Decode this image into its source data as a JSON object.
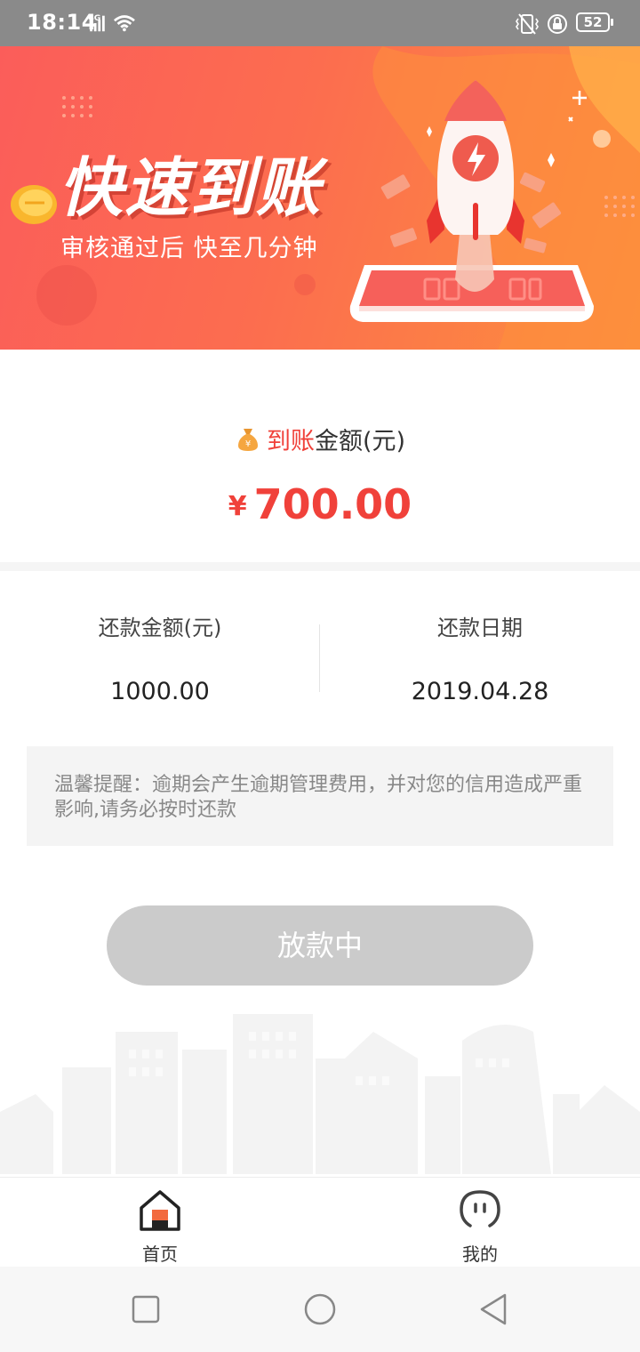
{
  "status_bar": {
    "time": "18:14",
    "network": "4G",
    "battery": "52"
  },
  "banner": {
    "title": "快速到账",
    "subtitle": "审核通过后 快至几分钟"
  },
  "amount": {
    "label_highlight": "到账",
    "label_rest": "金额(元)",
    "currency": "¥",
    "value": "700.00"
  },
  "repay": {
    "amount_label": "还款金额(元)",
    "amount_value": "1000.00",
    "date_label": "还款日期",
    "date_value": "2019.04.28"
  },
  "reminder": "温馨提醒：逾期会产生逾期管理费用，并对您的信用造成严重影响,请务必按时还款",
  "status_button": "放款中",
  "tabs": [
    {
      "label": "首页",
      "icon": "home-icon",
      "active": true
    },
    {
      "label": "我的",
      "icon": "profile-icon",
      "active": false
    }
  ],
  "colors": {
    "accent": "#f0413a",
    "banner_start": "#fb5d5a",
    "banner_end": "#fd8f3d",
    "button_disabled": "#cbcbcb"
  }
}
